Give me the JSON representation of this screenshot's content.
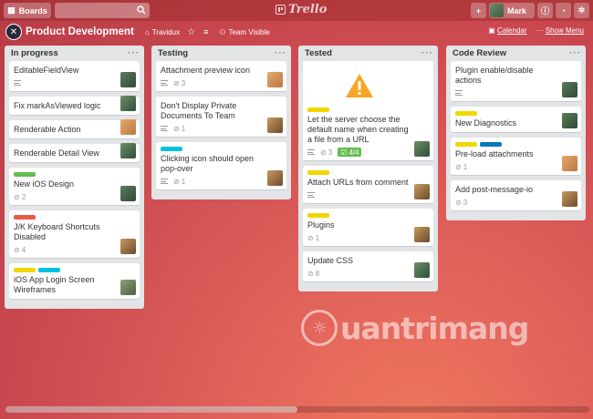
{
  "header": {
    "boards_label": "Boards",
    "search_placeholder": "",
    "logo_text": "Trello",
    "user_name": "Mark"
  },
  "board": {
    "title": "Product Development",
    "team": "Travidux",
    "visibility": "Team Visible",
    "calendar_label": "Calendar",
    "show_menu_label": "Show Menu"
  },
  "colors": {
    "green": "#61bd4f",
    "yellow": "#f2d600",
    "orange": "#ffab4a",
    "red": "#eb5a46",
    "sky": "#00c2e0",
    "blue": "#0079bf"
  },
  "lists": [
    {
      "title": "In progress",
      "cards": [
        {
          "title": "EditableFieldView",
          "labels": [],
          "desc": true,
          "comments": "",
          "member": "m1"
        },
        {
          "title": "Fix markAsViewed logic",
          "labels": [],
          "desc": false,
          "comments": "",
          "member": "m2"
        },
        {
          "title": "Renderable Action",
          "labels": [],
          "desc": false,
          "comments": "",
          "member": "m3"
        },
        {
          "title": "Renderable Detail View",
          "labels": [],
          "desc": false,
          "comments": "",
          "member": "m2"
        },
        {
          "title": "New iOS Design",
          "labels": [
            "green"
          ],
          "desc": false,
          "comments": "2",
          "member": "m1"
        },
        {
          "title": "J/K Keyboard Shortcuts Disabled",
          "labels": [
            "red"
          ],
          "desc": false,
          "comments": "4",
          "member": "m4"
        },
        {
          "title": "iOS App Login Screen Wireframes",
          "labels": [
            "yellow",
            "sky"
          ],
          "desc": false,
          "comments": "",
          "member": "m5"
        }
      ]
    },
    {
      "title": "Testing",
      "cards": [
        {
          "title": "Attachment preview icon",
          "labels": [],
          "desc": true,
          "comments": "3",
          "member": "m3"
        },
        {
          "title": "Don't Display Private Documents To Team",
          "labels": [],
          "desc": true,
          "comments": "1",
          "member": "m4"
        },
        {
          "title": "Clicking icon should open pop-over",
          "labels": [
            "sky"
          ],
          "desc": true,
          "comments": "1",
          "member": "m4"
        }
      ]
    },
    {
      "title": "Tested",
      "cards": [
        {
          "title": "Let the server choose the default name when creating a file from a URL",
          "labels": [
            "yellow"
          ],
          "desc": true,
          "comments": "3",
          "checklist": "4/4",
          "member": "m2",
          "cover": true
        },
        {
          "title": "Attach URLs from comment",
          "labels": [
            "yellow"
          ],
          "desc": true,
          "comments": "",
          "member": "m4"
        },
        {
          "title": "Plugins",
          "labels": [
            "yellow"
          ],
          "desc": false,
          "comments": "1",
          "member": "m4"
        },
        {
          "title": "Update CSS",
          "labels": [],
          "desc": false,
          "comments": "8",
          "member": "m2"
        }
      ]
    },
    {
      "title": "Code Review",
      "cards": [
        {
          "title": "Plugin enable/disable actions",
          "labels": [],
          "desc": true,
          "comments": "",
          "member": "m1"
        },
        {
          "title": "New Diagnostics",
          "labels": [
            "yellow"
          ],
          "desc": false,
          "comments": "",
          "member": "m1"
        },
        {
          "title": "Pre-load attachments",
          "labels": [
            "yellow",
            "blue"
          ],
          "desc": false,
          "comments": "1",
          "member": "m3"
        },
        {
          "title": "Add post-message-io",
          "labels": [],
          "desc": false,
          "comments": "3",
          "member": "m4"
        }
      ]
    }
  ],
  "watermark": "uantrimang"
}
